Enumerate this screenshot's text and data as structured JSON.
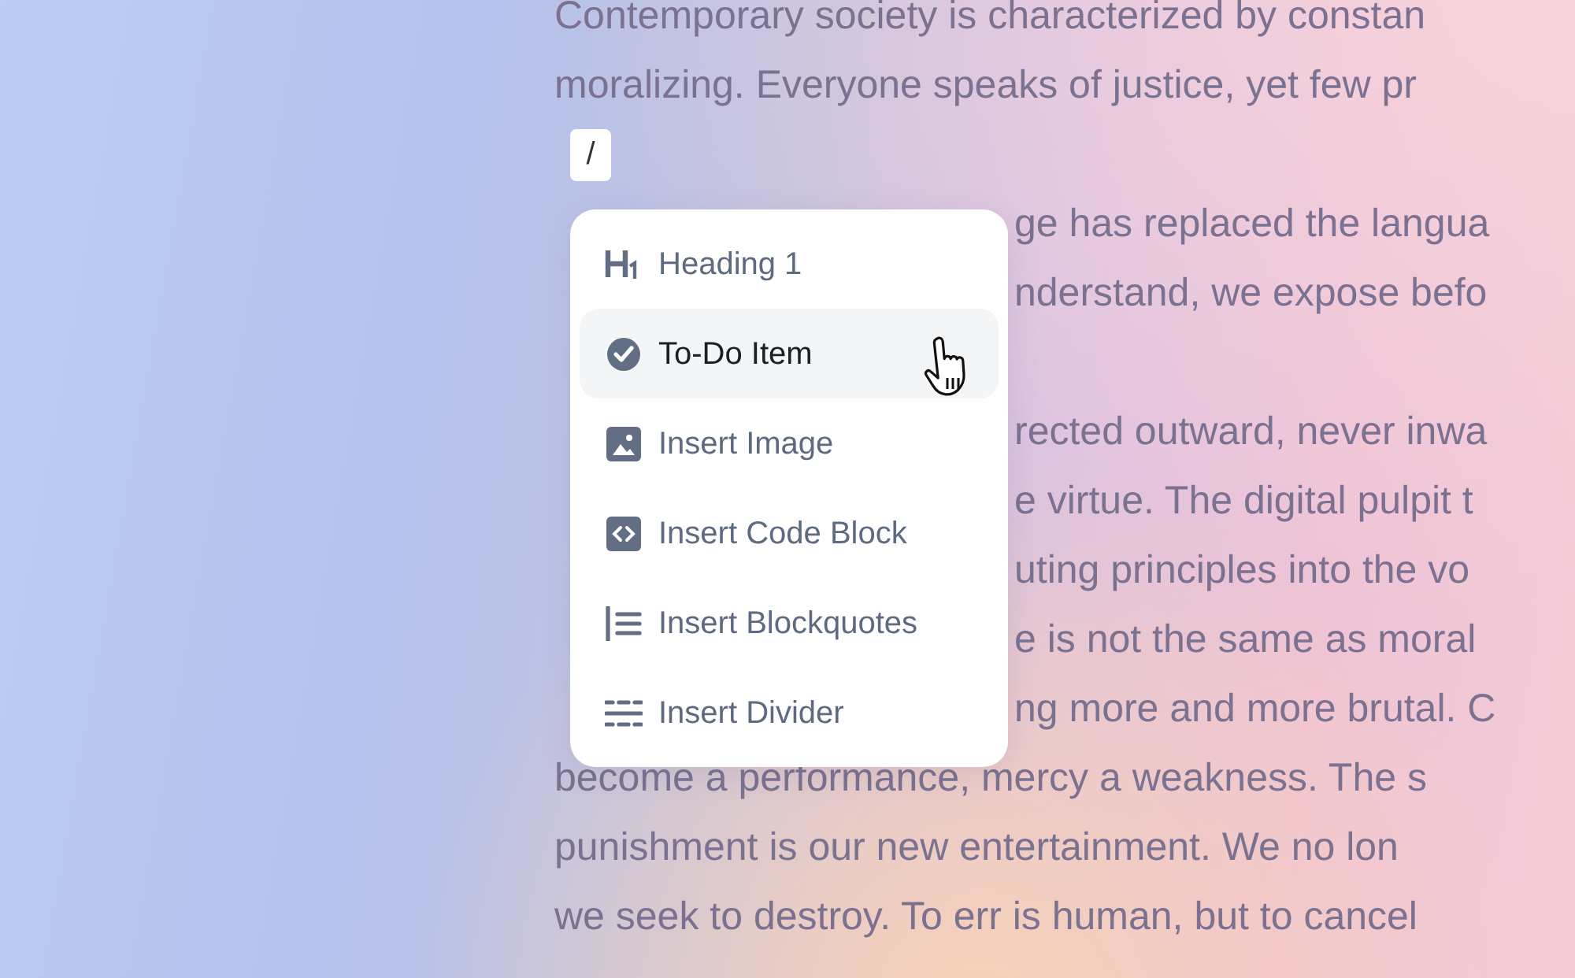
{
  "document": {
    "blocks": [
      {
        "kind": "line",
        "text": "Contemporary society is characterized by constan"
      },
      {
        "kind": "line",
        "text": "moralizing. Everyone speaks of justice, yet few pr"
      },
      {
        "kind": "command",
        "value": "/"
      },
      {
        "kind": "covered_line",
        "text": "ge has replaced the langua"
      },
      {
        "kind": "covered_line",
        "text": "nderstand, we expose befo"
      },
      {
        "kind": "blank"
      },
      {
        "kind": "covered_line",
        "text": "rected outward, never inwa"
      },
      {
        "kind": "covered_line",
        "text": "e virtue. The digital pulpit t"
      },
      {
        "kind": "covered_line",
        "text": "uting principles into the vo"
      },
      {
        "kind": "covered_line",
        "text": "e is not the same as moral"
      },
      {
        "kind": "covered_line",
        "text": "ng more and more brutal. C"
      },
      {
        "kind": "line",
        "text": "become a performance, mercy a weakness. The s"
      },
      {
        "kind": "line",
        "text": "punishment is our new entertainment. We no lon"
      },
      {
        "kind": "line",
        "text": "we seek to destroy. To err is human, but to cancel"
      }
    ]
  },
  "slash_menu": {
    "items": [
      {
        "kind": "heading",
        "label": "Heading 1",
        "selected": false
      },
      {
        "kind": "todo",
        "label": "To-Do Item",
        "selected": true
      },
      {
        "kind": "image",
        "label": "Insert Image",
        "selected": false
      },
      {
        "kind": "code",
        "label": "Insert Code Block",
        "selected": false
      },
      {
        "kind": "blockquote",
        "label": "Insert Blockquotes",
        "selected": false
      },
      {
        "kind": "divider",
        "label": "Insert Divider",
        "selected": false
      }
    ]
  }
}
